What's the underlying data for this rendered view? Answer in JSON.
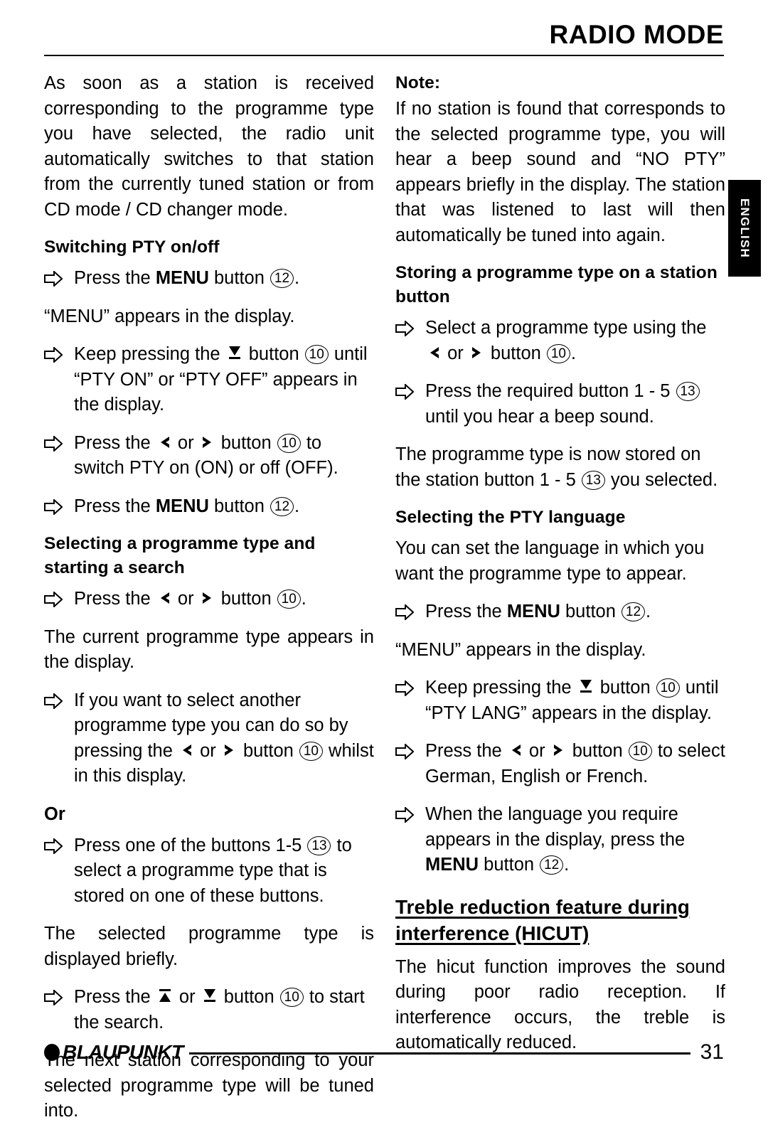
{
  "header": {
    "title": "RADIO MODE"
  },
  "side_tab": {
    "label": "ENGLISH"
  },
  "icons": {
    "bullet": "hollow-right-arrow-icon",
    "up_button": "up-arrow-glyph",
    "down_button": "down-arrow-glyph",
    "left_button": "left-chevron-glyph",
    "right_button": "right-chevron-glyph"
  },
  "refs": {
    "btn10": "10",
    "btn12": "12",
    "btn13": "13"
  },
  "left_column": {
    "intro_para": "As soon as a station is received corresponding to the programme type you have selected, the radio unit automatically switches to that station from the currently tuned station or from CD mode / CD changer mode.",
    "switching_pty_head": "Switching PTY on/off",
    "step1_pre": "Press the ",
    "step1_kw": "MENU",
    "step1_mid": " button ",
    "step1_post": ".",
    "menu_display_note": "“MENU” appears in the display.",
    "step2_pre": "Keep pressing the ",
    "step2_mid": " button ",
    "step2_post": " until “PTY ON” or “PTY OFF” appears in the display.",
    "step3_pre": "Press the ",
    "step3_mid": " or ",
    "step3_mid2": " button ",
    "step3_post": " to switch PTY on (ON) or off (OFF).",
    "step4_pre": "Press the ",
    "step4_kw": "MENU",
    "step4_mid": " button ",
    "step4_post": ".",
    "selecting_head": "Selecting a programme type and starting a search",
    "step5_pre": "Press the ",
    "step5_mid": " or ",
    "step5_mid2": " button ",
    "step5_post": ".",
    "current_type_para": "The current programme type appears in the display.",
    "step6_pre": "If you want to select another programme type you can do so by pressing the ",
    "step6_mid": " or ",
    "step6_mid2": " button ",
    "step6_post": " whilst in this display.",
    "or_head": "Or",
    "step7_pre": "Press one of the buttons 1-5 ",
    "step7_post": " to select a programme type that is stored on one of these buttons.",
    "displayed_briefly_para": "The selected programme type is displayed briefly.",
    "step8_pre": "Press the ",
    "step8_mid": " or ",
    "step8_mid2": " button ",
    "step8_post": " to start the search.",
    "next_station_para": "The next station corresponding to your selected programme type will be tuned into."
  },
  "right_column": {
    "note_head": "Note:",
    "note_para": "If no station is found that corresponds to the selected programme type, you will hear a beep sound and “NO PTY” appears briefly in the display. The station that was listened to last will then automatically be tuned into again.",
    "storing_head": "Storing a programme type on a station button",
    "step1_pre": "Select a programme type using the ",
    "step1_mid": " or ",
    "step1_mid2": " button ",
    "step1_post": ".",
    "step2_pre": "Press the required button 1 - 5 ",
    "step2_post": " until you hear a beep sound.",
    "stored_para_pre": "The programme type is now stored on the station button  1 - 5 ",
    "stored_para_post": " you selected.",
    "pty_lang_head": "Selecting the PTY language",
    "lang_intro_para": "You can set the language in which you want the programme type to appear.",
    "step3_pre": "Press the ",
    "step3_kw": "MENU",
    "step3_mid": " button ",
    "step3_post": ".",
    "menu_display_note": "“MENU” appears in the display.",
    "step4_pre": "Keep pressing the ",
    "step4_mid": " button ",
    "step4_post": " until “PTY LANG” appears in the display.",
    "step5_pre": "Press the ",
    "step5_mid": " or ",
    "step5_mid2": " button ",
    "step5_post": " to select German, English or French.",
    "step6_pre": "When the language you require appears in the display, press the ",
    "step6_kw": "MENU",
    "step6_mid": " button ",
    "step6_post": ".",
    "hicut_head": "Treble reduction feature during interference (HICUT)",
    "hicut_para": "The hicut function improves the sound during poor radio reception. If interference occurs, the treble is automatically reduced."
  },
  "footer": {
    "brand": "BLAUPUNKT",
    "page_number": "31"
  }
}
